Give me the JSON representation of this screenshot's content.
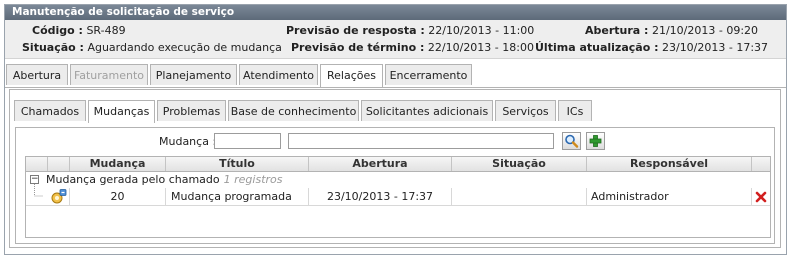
{
  "panel": {
    "title": "Manutenção de solicitação de serviço"
  },
  "summary": {
    "codigo_label": "Código :",
    "codigo_value": "SR-489",
    "situacao_label": "Situação :",
    "situacao_value": "Aguardando execução de mudança",
    "prev_resposta_label": "Previsão de resposta :",
    "prev_resposta_value": "22/10/2013 - 11:00",
    "prev_termino_label": "Previsão de término :",
    "prev_termino_value": "22/10/2013 - 18:00",
    "abertura_label": "Abertura :",
    "abertura_value": "21/10/2013 - 09:20",
    "ultima_label": "Última atualização :",
    "ultima_value": "23/10/2013 - 17:37"
  },
  "main_tabs": [
    "Abertura",
    "Faturamento",
    "Planejamento",
    "Atendimento",
    "Relações",
    "Encerramento"
  ],
  "sub_tabs": [
    "Chamados",
    "Mudanças",
    "Problemas",
    "Base de conhecimento",
    "Solicitantes adicionais",
    "Serviços",
    "ICs"
  ],
  "search": {
    "label": "Mudança :",
    "code_value": "",
    "text_value": ""
  },
  "grid": {
    "columns": [
      "Mudança",
      "Título",
      "Abertura",
      "Situação",
      "Responsável"
    ],
    "group_label": "Mudança gerada pelo chamado",
    "group_count": "1 registros",
    "rows": [
      {
        "mudanca": "20",
        "titulo": "Mudança programada",
        "abertura": "23/10/2013 - 17:37",
        "situacao": "",
        "responsavel": "Administrador"
      }
    ]
  },
  "colors": {
    "title_bar": "#6b7886",
    "delete": "#d21f1f",
    "add": "#2f9a2f"
  }
}
